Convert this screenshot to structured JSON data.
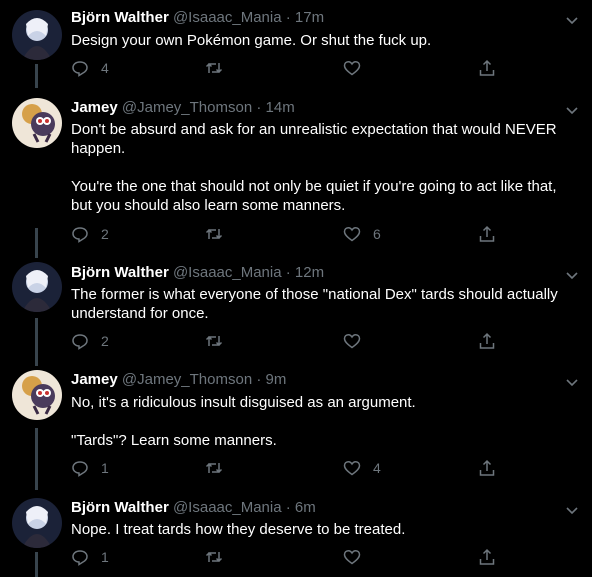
{
  "tweets": [
    {
      "name": "Björn Walther",
      "handle": "@Isaaac_Mania",
      "time": "17m",
      "text": "Design your own Pokémon game. Or shut the fuck up.",
      "replies": "4",
      "retweets": "",
      "likes": ""
    },
    {
      "name": "Jamey",
      "handle": "@Jamey_Thomson",
      "time": "14m",
      "text": "Don't be absurd and ask for an unrealistic expectation that would NEVER\nhappen.\n\nYou're the one that should not only be quiet if you're going to act like that,\nbut you should also learn some manners.",
      "replies": "2",
      "retweets": "",
      "likes": "6"
    },
    {
      "name": "Björn Walther",
      "handle": "@Isaaac_Mania",
      "time": "12m",
      "text": "The former is what everyone of those \"national Dex\" tards should actually\nunderstand for once.",
      "replies": "2",
      "retweets": "",
      "likes": ""
    },
    {
      "name": "Jamey",
      "handle": "@Jamey_Thomson",
      "time": "9m",
      "text": "No, it's a ridiculous insult disguised as an argument.\n\n\"Tards\"? Learn some manners.",
      "replies": "1",
      "retweets": "",
      "likes": "4"
    },
    {
      "name": "Björn Walther",
      "handle": "@Isaaac_Mania",
      "time": "6m",
      "text": "Nope. I treat tards how they deserve to be treated.",
      "replies": "1",
      "retweets": "",
      "likes": ""
    }
  ],
  "icons": {
    "reply": "reply-icon",
    "retweet": "retweet-icon",
    "like": "heart-icon",
    "share": "share-icon",
    "caret": "chevron-down-icon"
  },
  "colors": {
    "background": "#000000",
    "text": "#ffffff",
    "muted": "#6e767d",
    "thread_line": "#38444d"
  }
}
